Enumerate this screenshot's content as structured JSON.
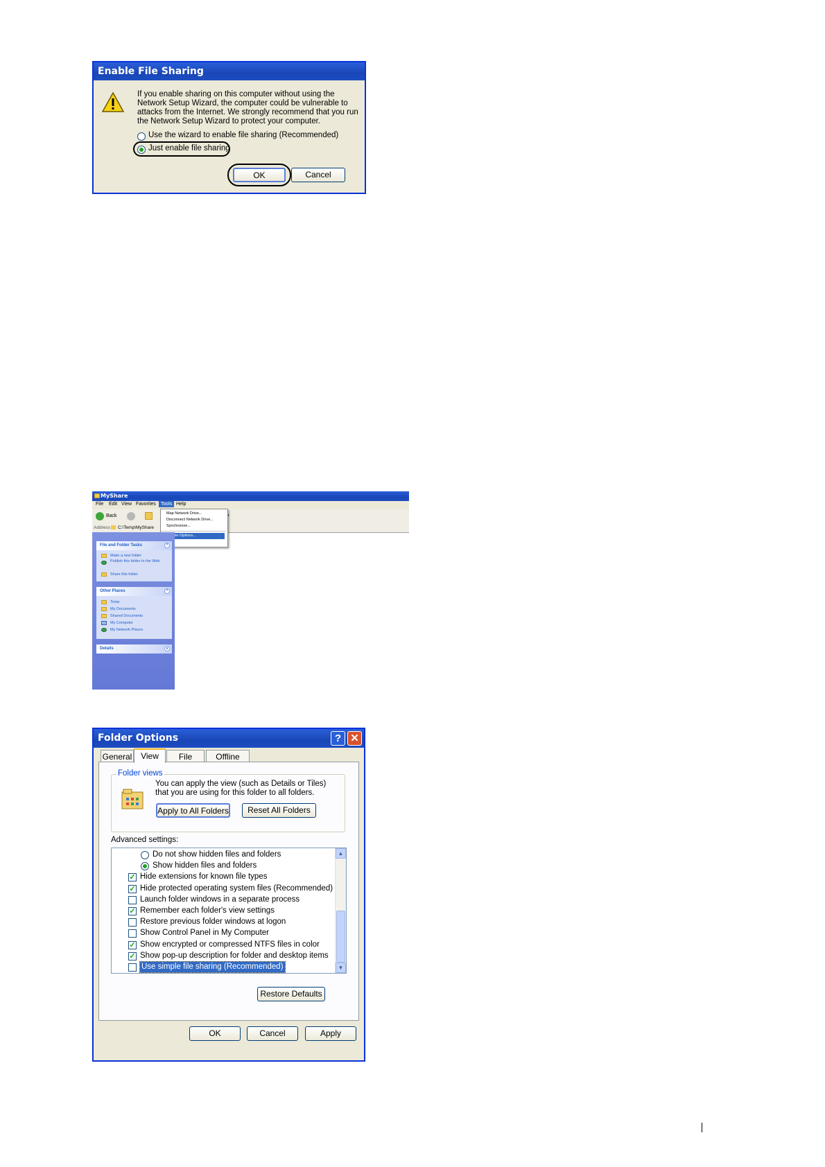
{
  "dialog1": {
    "title": "Enable File Sharing",
    "message": "If you enable sharing on this computer without using the Network Setup Wizard, the computer could be vulnerable to attacks from the Internet. We strongly recommend that you run the Network Setup Wizard to protect your computer.",
    "radio1": "Use the wizard to enable file sharing (Recommended)",
    "radio2": "Just enable file sharing",
    "ok": "OK",
    "cancel": "Cancel",
    "icon": "warning-icon"
  },
  "explorer": {
    "title": "MyShare",
    "menu": [
      "File",
      "Edit",
      "View",
      "Favorites",
      "Tools",
      "Help"
    ],
    "back": "Back",
    "address_label": "Address",
    "address_value": "C:\\Temp\\MyShare",
    "tools_menu": [
      "Map Network Drive...",
      "Disconnect Network Drive...",
      "Synchronize...",
      "Folder Options..."
    ],
    "file_tasks_title": "File and Folder Tasks",
    "file_tasks": [
      "Make a new folder",
      "Publish this folder to the Web",
      "Share this folder"
    ],
    "other_places_title": "Other Places",
    "other_places": [
      "Temp",
      "My Documents",
      "Shared Documents",
      "My Computer",
      "My Network Places"
    ],
    "details_title": "Details"
  },
  "dialog2": {
    "title": "Folder Options",
    "help": "?",
    "close": "✕",
    "tabs": [
      "General",
      "View",
      "File Types",
      "Offline Files"
    ],
    "folder_views_legend": "Folder views",
    "folder_views_text": "You can apply the view (such as Details or Tiles) that you are using for this folder to all folders.",
    "apply_all": "Apply to All Folders",
    "reset_all": "Reset All Folders",
    "advanced_label": "Advanced settings:",
    "options": [
      {
        "type": "radio",
        "checked": false,
        "label": "Do not show hidden files and folders"
      },
      {
        "type": "radio",
        "checked": true,
        "label": "Show hidden files and folders"
      },
      {
        "type": "check",
        "checked": true,
        "label": "Hide extensions for known file types"
      },
      {
        "type": "check",
        "checked": true,
        "label": "Hide protected operating system files (Recommended)"
      },
      {
        "type": "check",
        "checked": false,
        "label": "Launch folder windows in a separate process"
      },
      {
        "type": "check",
        "checked": true,
        "label": "Remember each folder's view settings"
      },
      {
        "type": "check",
        "checked": false,
        "label": "Restore previous folder windows at logon"
      },
      {
        "type": "check",
        "checked": false,
        "label": "Show Control Panel in My Computer"
      },
      {
        "type": "check",
        "checked": true,
        "label": "Show encrypted or compressed NTFS files in color"
      },
      {
        "type": "check",
        "checked": true,
        "label": "Show pop-up description for folder and desktop items"
      },
      {
        "type": "check",
        "checked": false,
        "label": "Use simple file sharing (Recommended)"
      }
    ],
    "restore_defaults": "Restore Defaults",
    "ok": "OK",
    "cancel": "Cancel",
    "apply": "Apply"
  }
}
